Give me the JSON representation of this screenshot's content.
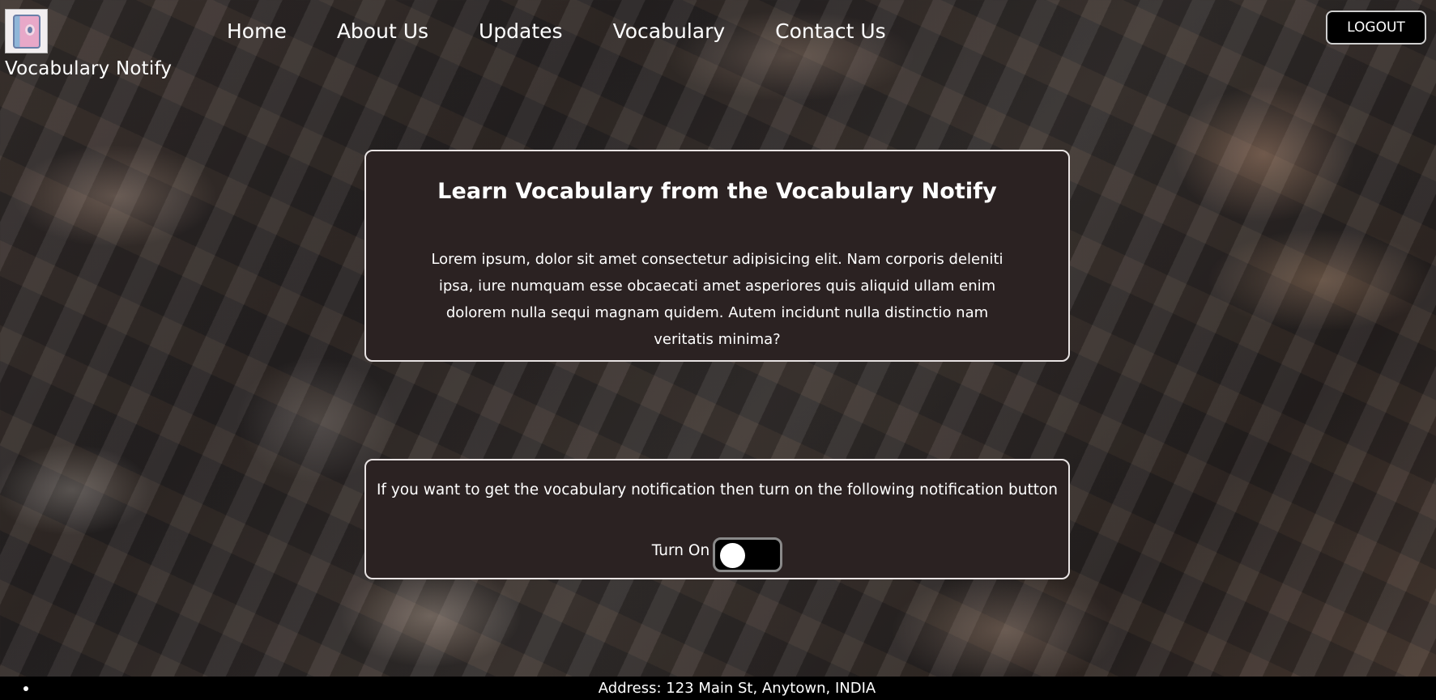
{
  "header": {
    "logo_icon": "book-icon",
    "brand": "Vocabulary Notify",
    "nav": [
      {
        "label": "Home"
      },
      {
        "label": "About Us"
      },
      {
        "label": "Updates"
      },
      {
        "label": "Vocabulary"
      },
      {
        "label": "Contact Us"
      }
    ],
    "logout_label": "LOGOUT"
  },
  "learn_card": {
    "title": "Learn Vocabulary from the Vocabulary Notify",
    "body": "Lorem ipsum, dolor sit amet consectetur adipisicing elit. Nam corporis deleniti ipsa, iure numquam esse obcaecati amet asperiores quis aliquid ullam enim dolorem nulla sequi magnam quidem. Autem incidunt nulla distinctio nam veritatis minima?"
  },
  "notify_card": {
    "text": "If you want to get the vocabulary notification then turn on the following notification button",
    "toggle_label": "Turn On",
    "toggle_state": "off"
  },
  "footer": {
    "address": "Address: 123 Main St, Anytown, INDIA"
  },
  "colors": {
    "card_bg": "#2b2222",
    "card_border": "#e8e3e3",
    "footer_bg": "#000000",
    "button_bg": "#000000"
  }
}
